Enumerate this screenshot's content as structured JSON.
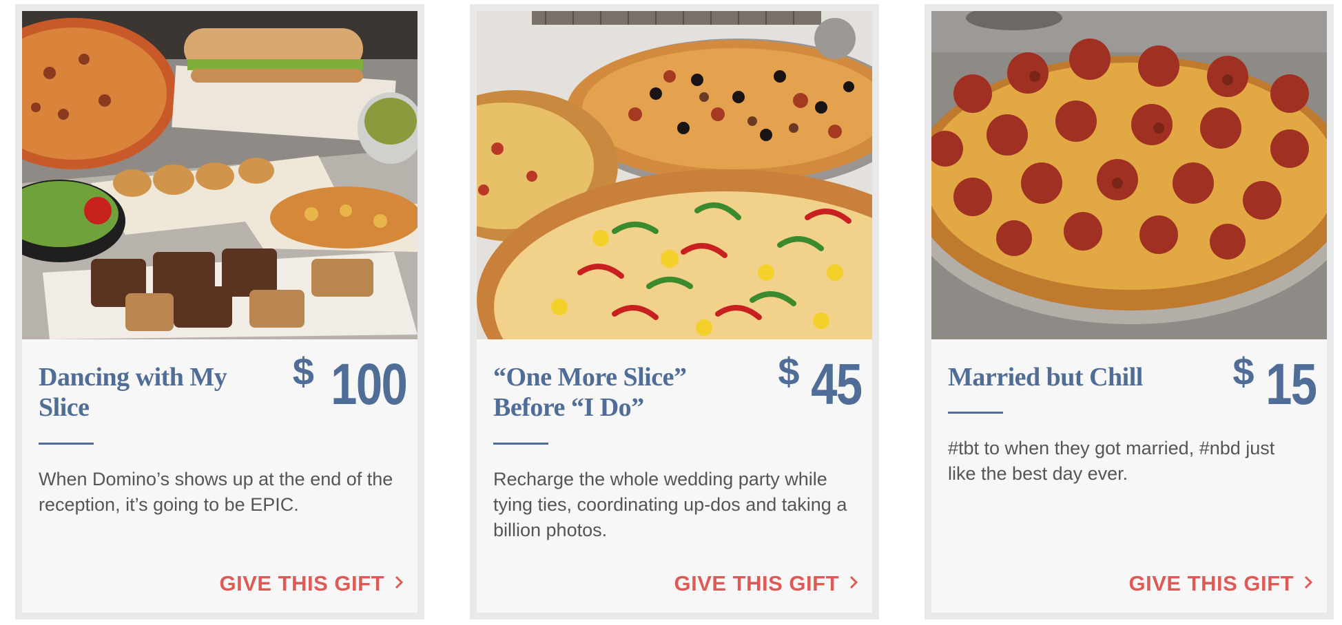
{
  "cards": [
    {
      "title": "Dancing with My Slice",
      "currency": "$",
      "amount": "100",
      "description": "When Domino’s shows up at the end of the reception, it’s going to be EPIC.",
      "cta": "GIVE THIS GIFT",
      "cta_icon": "chevron-right-icon",
      "image": "food-spread-image"
    },
    {
      "title": "“One More Slice” Before “I Do”",
      "currency": "$",
      "amount": "45",
      "description": "Recharge the whole wedding party while tying ties, coordinating up-dos and taking a billion photos.",
      "cta": "GIVE THIS GIFT",
      "cta_icon": "chevron-right-icon",
      "image": "two-pizzas-image"
    },
    {
      "title": "Married but Chill",
      "currency": "$",
      "amount": "15",
      "description": "#tbt to when they got married, #nbd just like the best day ever.",
      "cta": "GIVE THIS GIFT",
      "cta_icon": "chevron-right-icon",
      "image": "pepperoni-pizza-image"
    }
  ],
  "colors": {
    "title": "#4f6d96",
    "cta": "#e05a55",
    "body_text": "#555555",
    "card_bg": "#f7f7f7",
    "card_border": "#e9e9e9"
  }
}
